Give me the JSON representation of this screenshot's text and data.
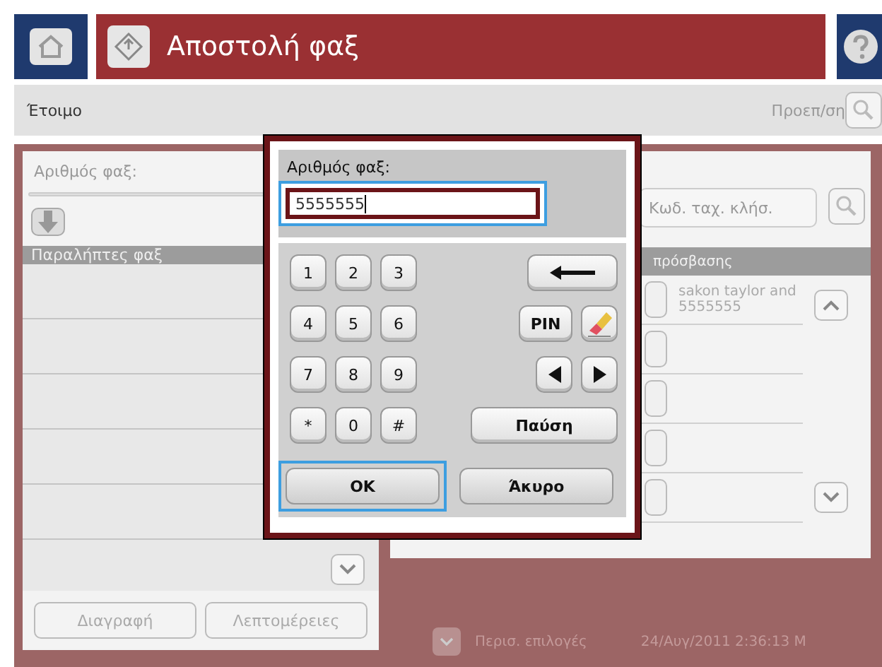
{
  "header": {
    "title": "Αποστολή φαξ"
  },
  "status_bar": {
    "status": "Έτοιμο",
    "preset_label": "Προεπ/ση"
  },
  "left_panel": {
    "field_label": "Αριθμός φαξ:",
    "list_header": "Παραλήπτες φαξ",
    "buttons": [
      "Διαγραφή",
      "Λεπτομέρειες"
    ]
  },
  "right_panel": {
    "speed_dial_placeholder": "Κωδ. ταχ. κλήσ.",
    "list_header": "πρόσβασης",
    "entries": [
      {
        "name": "sakon taylor and 5555555"
      }
    ]
  },
  "footer": {
    "more_options": "Περισ. επιλογές",
    "datetime": "24/Αυγ/2011 2:36:13 Μ"
  },
  "dialog": {
    "label": "Αριθμός φαξ:",
    "value": "5555555",
    "field_highlighted": true,
    "rows": [
      {
        "digits": [
          "1",
          "2",
          "3"
        ],
        "actions": [
          {
            "kind": "backspace"
          }
        ]
      },
      {
        "digits": [
          "4",
          "5",
          "6"
        ],
        "actions": [
          {
            "kind": "text",
            "label": "PIN"
          },
          {
            "kind": "eraser"
          }
        ]
      },
      {
        "digits": [
          "7",
          "8",
          "9"
        ],
        "actions": [
          {
            "kind": "left"
          },
          {
            "kind": "right"
          }
        ]
      },
      {
        "digits": [
          "*",
          "0",
          "#"
        ],
        "actions": [
          {
            "kind": "wide",
            "label": "Παύση"
          }
        ]
      }
    ],
    "ok": {
      "label": "OK",
      "highlighted": true
    },
    "cancel": {
      "label": "Άκυρο",
      "highlighted": false
    }
  }
}
